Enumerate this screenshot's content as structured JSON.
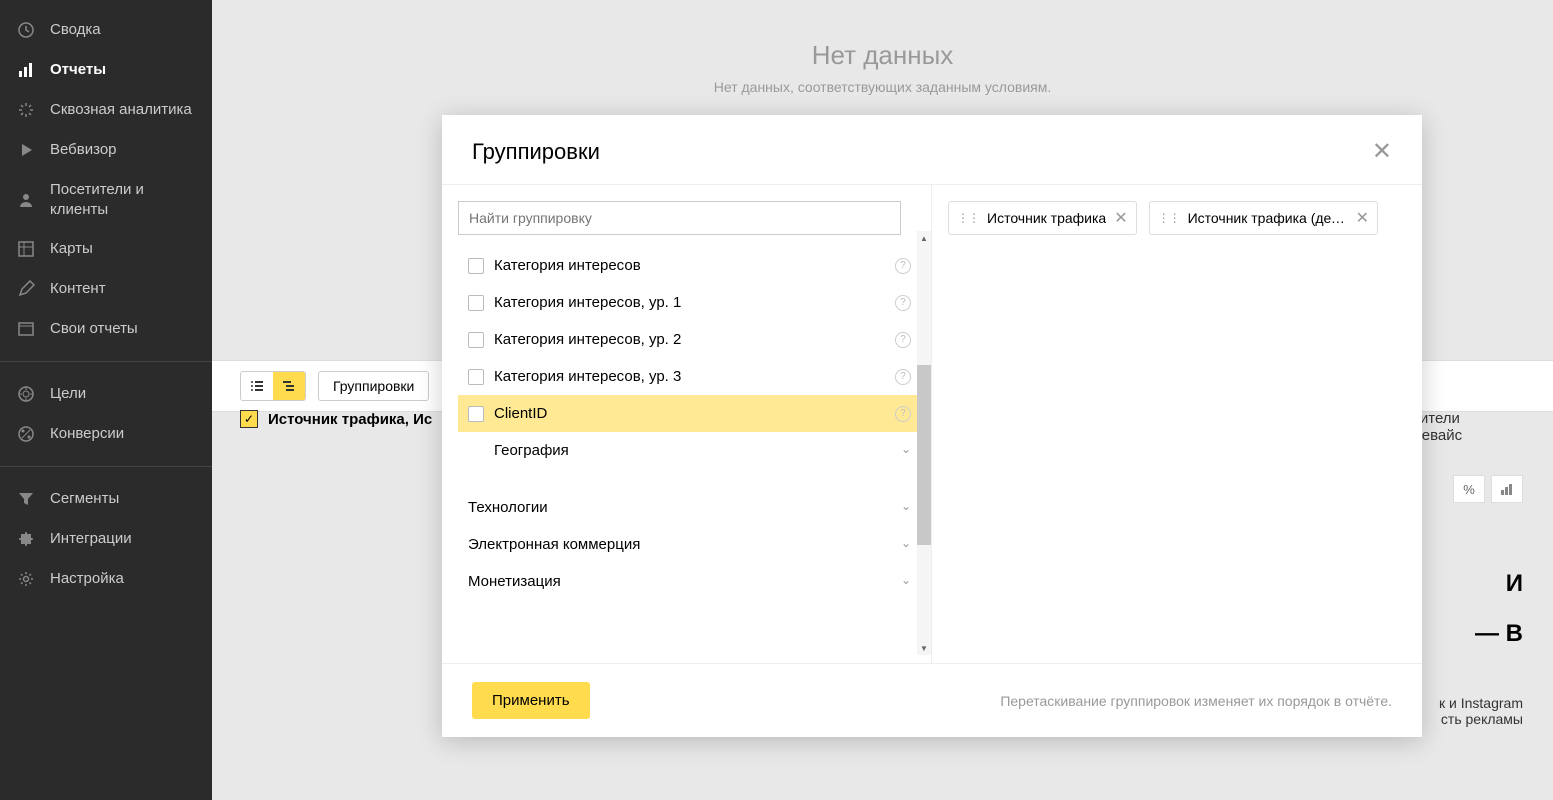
{
  "sidebar": {
    "items": [
      {
        "label": "Сводка",
        "icon": "clock"
      },
      {
        "label": "Отчеты",
        "icon": "bars",
        "active": true
      },
      {
        "label": "Сквозная аналитика",
        "icon": "burst"
      },
      {
        "label": "Вебвизор",
        "icon": "play"
      },
      {
        "label": "Посетители и клиенты",
        "icon": "user"
      },
      {
        "label": "Карты",
        "icon": "grid"
      },
      {
        "label": "Контент",
        "icon": "pencil"
      },
      {
        "label": "Свои отчеты",
        "icon": "window"
      }
    ],
    "items2": [
      {
        "label": "Цели",
        "icon": "target"
      },
      {
        "label": "Конверсии",
        "icon": "percent"
      }
    ],
    "items3": [
      {
        "label": "Сегменты",
        "icon": "funnel"
      },
      {
        "label": "Интеграции",
        "icon": "puzzle"
      },
      {
        "label": "Настройка",
        "icon": "gear"
      }
    ]
  },
  "main": {
    "noDataTitle": "Нет данных",
    "noDataText": "Нет данных, соответствующих заданным условиям.",
    "groupButton": "Группировки",
    "sourceLabel": "Источник трафика, Ис",
    "rightText1": "тители",
    "rightText2": "девайс",
    "percentSymbol": "%",
    "bigI": "И",
    "bigB": "— В",
    "smallText1": "к и Instagram",
    "smallText2": "сть рекламы"
  },
  "modal": {
    "title": "Группировки",
    "searchPlaceholder": "Найти группировку",
    "listItems": [
      {
        "label": "Категория интересов",
        "help": true
      },
      {
        "label": "Категория интересов, ур. 1",
        "help": true
      },
      {
        "label": "Категория интересов, ур. 2",
        "help": true
      },
      {
        "label": "Категория интересов, ур. 3",
        "help": true
      },
      {
        "label": "ClientID",
        "help": true,
        "highlighted": true
      }
    ],
    "categories": [
      {
        "label": "География"
      },
      {
        "label": "Технологии"
      },
      {
        "label": "Электронная коммерция"
      },
      {
        "label": "Монетизация"
      }
    ],
    "chips": [
      {
        "label": "Источник трафика"
      },
      {
        "label": "Источник трафика (деталь..."
      }
    ],
    "applyLabel": "Применить",
    "footerHint": "Перетаскивание группировок изменяет их порядок в отчёте."
  }
}
